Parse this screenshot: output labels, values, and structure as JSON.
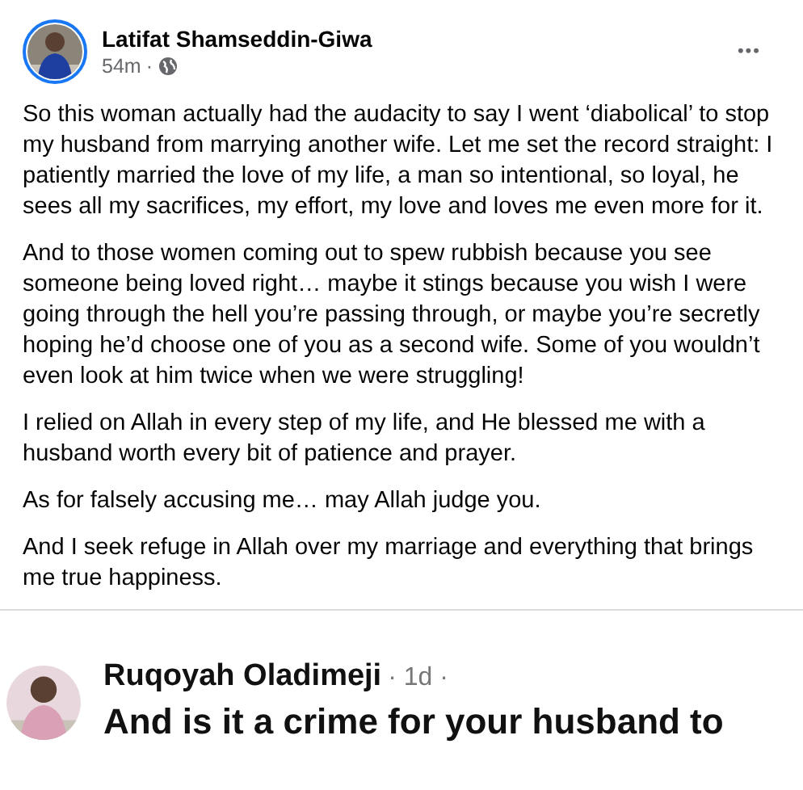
{
  "post": {
    "author": "Latifat Shamseddin-Giwa",
    "time": "54m",
    "separator": "·",
    "more": "•••",
    "paragraphs": [
      "So this woman actually had the audacity to say I went ‘diabolical’ to stop my husband from marrying another wife. Let me set the record straight: I patiently married the love of my life, a man so intentional, so loyal, he sees all my sacrifices, my effort, my love and loves me even more for it.",
      "And to those women coming out to spew rubbish because you see someone being loved right… maybe it stings because you wish I were going through the hell you’re passing through, or maybe you’re secretly hoping he’d choose one of you as a second wife. Some of you wouldn’t even look at him twice when we were struggling!",
      "I relied on Allah in every step of my life, and He blessed me with a husband worth every bit of patience and prayer.",
      "As for falsely accusing me… may Allah judge you.",
      "And I seek refuge in Allah over my marriage and everything that brings me true happiness."
    ]
  },
  "shared_comment": {
    "author": "Ruqoyah Oladimeji",
    "meta": "· 1d ·",
    "text": "And is it a crime for your husband to"
  }
}
